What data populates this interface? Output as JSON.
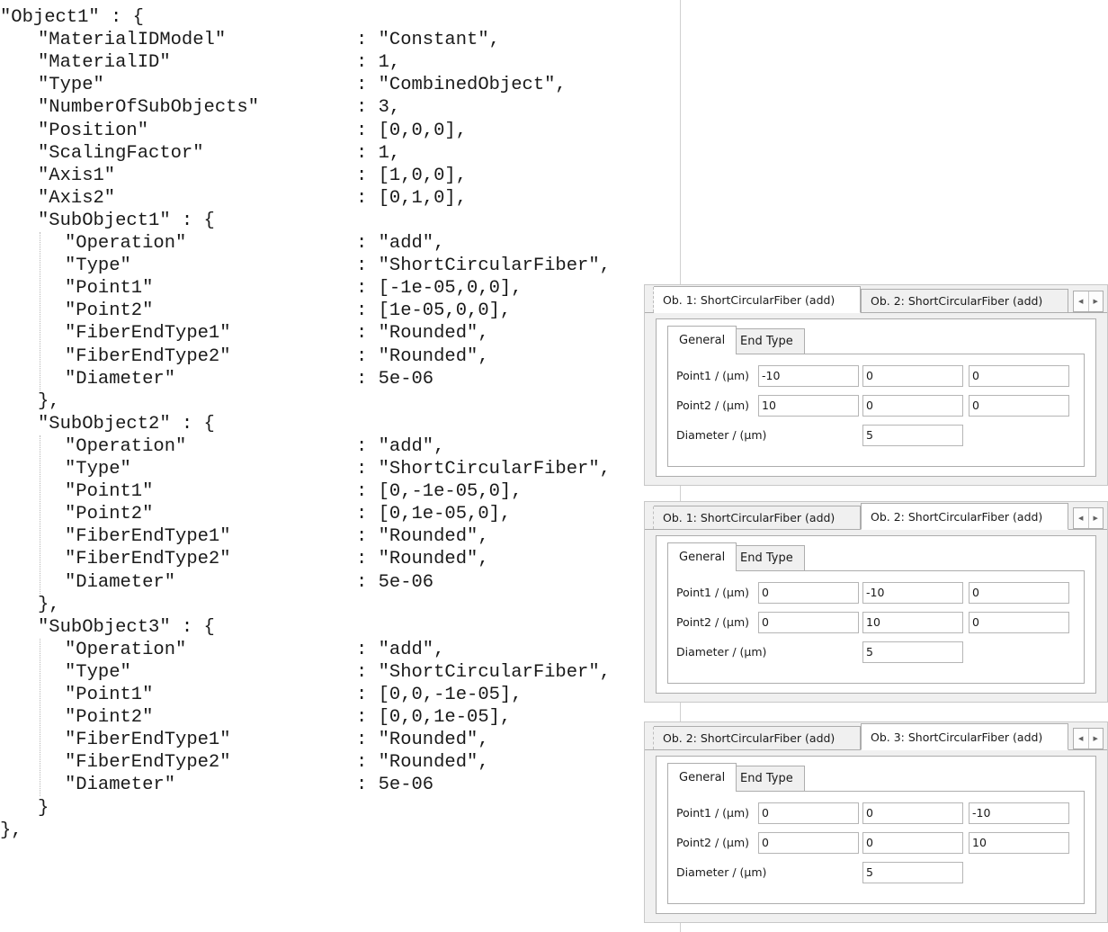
{
  "code": [
    {
      "k": "\"Object1\" : {",
      "v": ""
    },
    {
      "k": "\"MaterialIDModel\"",
      "v": ": \"Constant\","
    },
    {
      "k": "\"MaterialID\"",
      "v": ": 1,"
    },
    {
      "k": "\"Type\"",
      "v": ": \"CombinedObject\","
    },
    {
      "k": "\"NumberOfSubObjects\"",
      "v": ": 3,"
    },
    {
      "k": "\"Position\"",
      "v": ": [0,0,0],"
    },
    {
      "k": "\"ScalingFactor\"",
      "v": ": 1,"
    },
    {
      "k": "\"Axis1\"",
      "v": ": [1,0,0],"
    },
    {
      "k": "\"Axis2\"",
      "v": ": [0,1,0],"
    },
    {
      "k": "\"SubObject1\" : {",
      "v": ""
    },
    {
      "k": "\"Operation\"",
      "v": ": \"add\","
    },
    {
      "k": "\"Type\"",
      "v": ": \"ShortCircularFiber\","
    },
    {
      "k": "\"Point1\"",
      "v": ": [-1e-05,0,0],"
    },
    {
      "k": "\"Point2\"",
      "v": ": [1e-05,0,0],"
    },
    {
      "k": "\"FiberEndType1\"",
      "v": ": \"Rounded\","
    },
    {
      "k": "\"FiberEndType2\"",
      "v": ": \"Rounded\","
    },
    {
      "k": "\"Diameter\"",
      "v": ": 5e-06"
    },
    {
      "k": "},",
      "v": ""
    },
    {
      "k": "\"SubObject2\" : {",
      "v": ""
    },
    {
      "k": "\"Operation\"",
      "v": ": \"add\","
    },
    {
      "k": "\"Type\"",
      "v": ": \"ShortCircularFiber\","
    },
    {
      "k": "\"Point1\"",
      "v": ": [0,-1e-05,0],"
    },
    {
      "k": "\"Point2\"",
      "v": ": [0,1e-05,0],"
    },
    {
      "k": "\"FiberEndType1\"",
      "v": ": \"Rounded\","
    },
    {
      "k": "\"FiberEndType2\"",
      "v": ": \"Rounded\","
    },
    {
      "k": "\"Diameter\"",
      "v": ": 5e-06"
    },
    {
      "k": "},",
      "v": ""
    },
    {
      "k": "\"SubObject3\" : {",
      "v": ""
    },
    {
      "k": "\"Operation\"",
      "v": ": \"add\","
    },
    {
      "k": "\"Type\"",
      "v": ": \"ShortCircularFiber\","
    },
    {
      "k": "\"Point1\"",
      "v": ": [0,0,-1e-05],"
    },
    {
      "k": "\"Point2\"",
      "v": ": [0,0,1e-05],"
    },
    {
      "k": "\"FiberEndType1\"",
      "v": ": \"Rounded\","
    },
    {
      "k": "\"FiberEndType2\"",
      "v": ": \"Rounded\","
    },
    {
      "k": "\"Diameter\"",
      "v": ": 5e-06"
    },
    {
      "k": "}",
      "v": ""
    },
    {
      "k": "},",
      "v": ""
    }
  ],
  "labels": {
    "tab_general": "General",
    "tab_end_type": "End Type",
    "point1": "Point1 / (µm)",
    "point2": "Point2 / (µm)",
    "diameter": "Diameter / (µm)",
    "scroll_left": "◀",
    "scroll_right": "▶"
  },
  "windows": [
    {
      "tabs": [
        "Ob. 1: ShortCircularFiber (add)",
        "Ob. 2: ShortCircularFiber (add)"
      ],
      "active_tab": 0,
      "point1": [
        "-10",
        "0",
        "0"
      ],
      "point2": [
        "10",
        "0",
        "0"
      ],
      "diameter": "5"
    },
    {
      "tabs": [
        "Ob. 1: ShortCircularFiber (add)",
        "Ob. 2: ShortCircularFiber (add)"
      ],
      "active_tab": 1,
      "point1": [
        "0",
        "-10",
        "0"
      ],
      "point2": [
        "0",
        "10",
        "0"
      ],
      "diameter": "5"
    },
    {
      "tabs": [
        "Ob. 2: ShortCircularFiber (add)",
        "Ob. 3: ShortCircularFiber (add)"
      ],
      "active_tab": 1,
      "point1": [
        "0",
        "0",
        "-10"
      ],
      "point2": [
        "0",
        "0",
        "10"
      ],
      "diameter": "5"
    }
  ]
}
